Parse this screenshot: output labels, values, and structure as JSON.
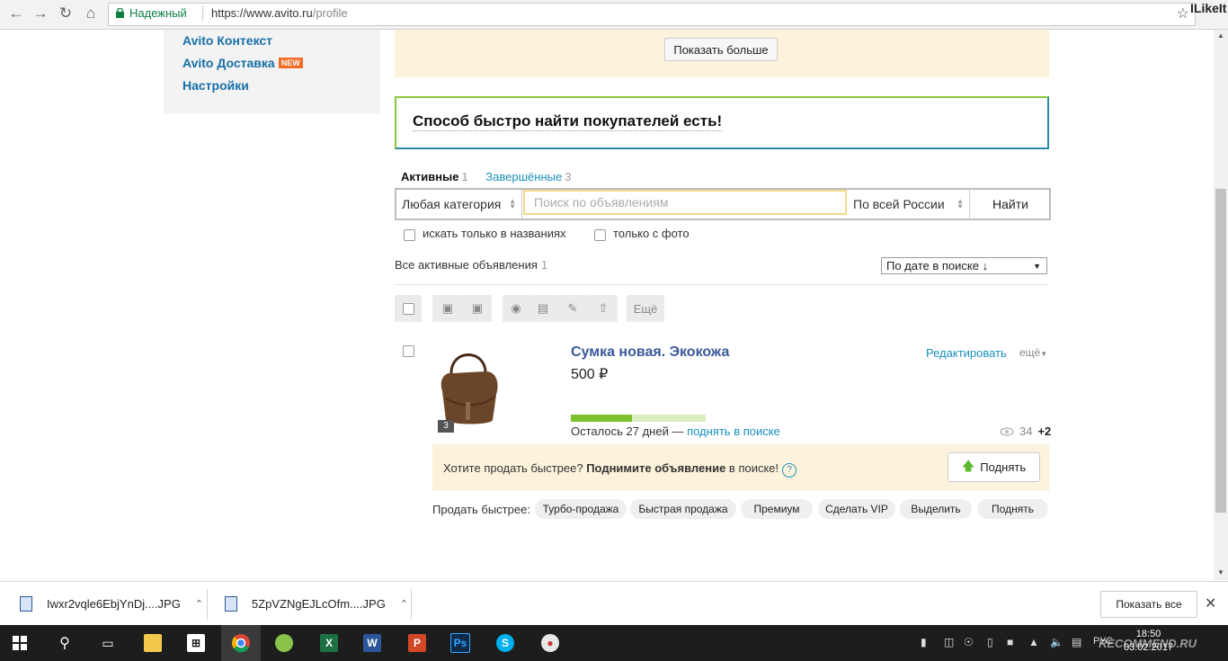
{
  "browser": {
    "secure_label": "Надежный",
    "url_host": "https://www.avito.ru",
    "url_path": "/profile",
    "extension_label": "ILikeIt"
  },
  "sidebar": {
    "items": [
      {
        "label": "Avito Контекст"
      },
      {
        "label": "Avito Доставка",
        "badge": "NEW"
      },
      {
        "label": "Настройки"
      }
    ]
  },
  "promo_top": {
    "show_more_label": "Показать больше"
  },
  "banner": {
    "text": "Способ быстро найти покупателей есть!"
  },
  "tabs": [
    {
      "label": "Активные",
      "count": "1"
    },
    {
      "label": "Завершённые",
      "count": "3"
    }
  ],
  "search": {
    "category": "Любая категория",
    "placeholder": "Поиск по объявлениям",
    "region": "По всей России",
    "submit_label": "Найти",
    "title_only_label": "искать только в названиях",
    "photo_only_label": "только с фото"
  },
  "listing_header": {
    "label": "Все активные объявления",
    "count": "1",
    "sort_value": "По дате в поиске ↓"
  },
  "toolbar": {
    "more_label": "Ещё"
  },
  "item": {
    "title": "Сумка новая. Экокожа",
    "price": "500 ₽",
    "photo_count": "3",
    "edit_label": "Редактировать",
    "more_label": "ещё",
    "progress_fraction": 0.45,
    "remaining_text": "Осталось 27 дней — ",
    "raise_link": "поднять в поиске",
    "views": "34",
    "views_delta": "+2"
  },
  "upsell": {
    "prefix": "Хотите продать быстрее? ",
    "bold": "Поднимите объявление",
    "suffix": " в поиске!",
    "help": "?",
    "button_label": "Поднять"
  },
  "sell_faster": {
    "label": "Продать быстрее:",
    "options": [
      "Турбо-продажа",
      "Быстрая продажа",
      "Премиум",
      "Сделать VIP",
      "Выделить",
      "Поднять"
    ]
  },
  "downloads": {
    "files": [
      "Iwxr2vqle6EbjYnDj....JPG",
      "5ZpVZNgEJLcOfm....JPG"
    ],
    "show_all_label": "Показать все"
  },
  "taskbar": {
    "time": "18:50",
    "date": "03.02.2017",
    "lang": "РУС",
    "watermark": "RECOMMEND.RU"
  },
  "colors": {
    "accent_link": "#1a8fbd",
    "title_link": "#3b5a9a",
    "promo_bg": "#fdf3dc",
    "progress_green": "#7cc22f"
  }
}
